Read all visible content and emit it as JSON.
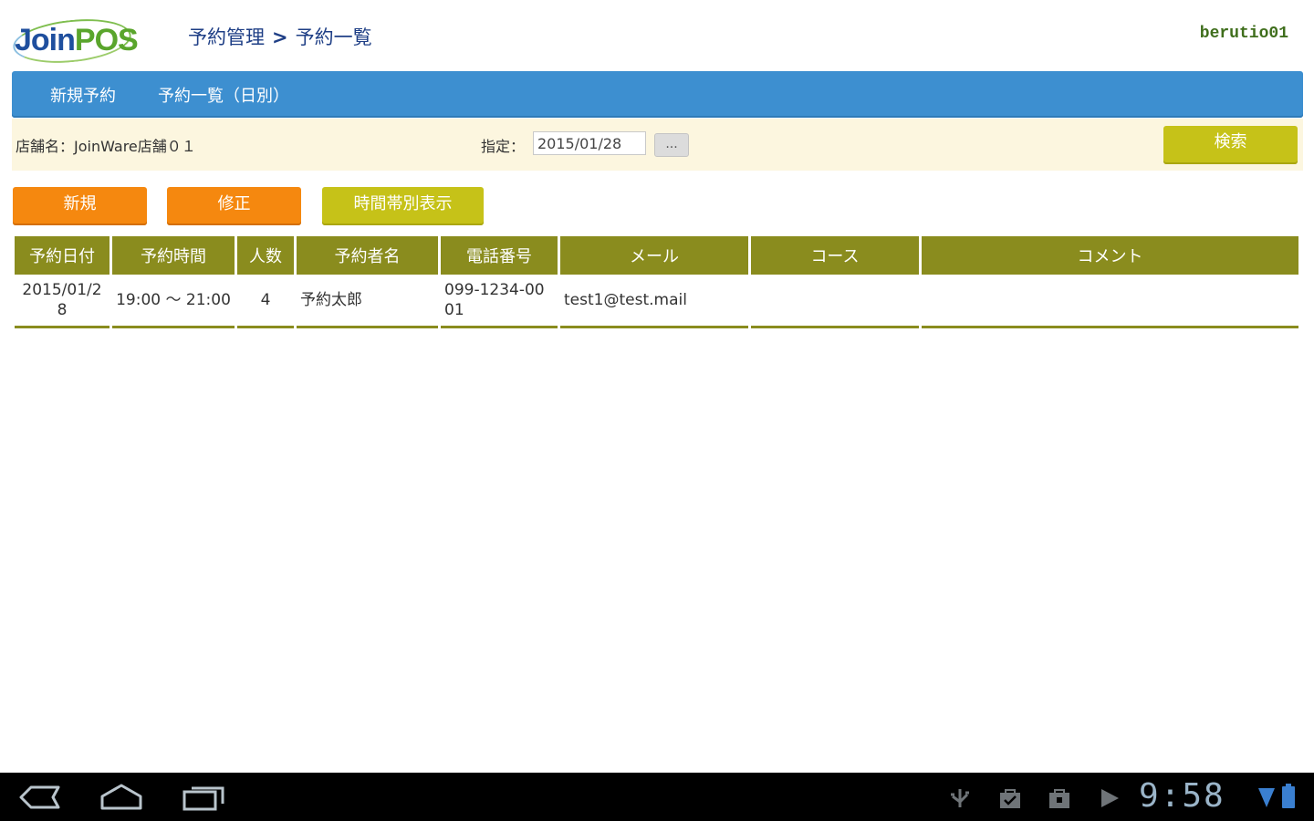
{
  "logo": {
    "part1": "Join",
    "part2": "POS"
  },
  "breadcrumb": {
    "section": "予約管理",
    "separator": ">",
    "page": "予約一覧"
  },
  "user": "berutio01",
  "nav": {
    "new_reservation": "新規予約",
    "daily_list": "予約一覧（日別）"
  },
  "filter": {
    "store_label": "店舗名：JoinWare店舗０１",
    "date_label": "指定：",
    "date_value": "2015/01/28",
    "date_picker": "...",
    "search_button": "検索"
  },
  "actions": {
    "new": "新規",
    "edit": "修正",
    "timeslot_view": "時間帯別表示"
  },
  "table": {
    "headers": [
      "予約日付",
      "予約時間",
      "人数",
      "予約者名",
      "電話番号",
      "メール",
      "コース",
      "コメント"
    ],
    "rows": [
      [
        "2015/01/28",
        "19:00 ～ 21:00",
        "4",
        "予約太郎",
        "099-1234-0001",
        "test1@test.mail",
        "",
        ""
      ]
    ]
  },
  "system_bar": {
    "clock": "9:58"
  },
  "colors": {
    "nav_blue": "#3d8fd0",
    "olive_header": "#8a8c1e",
    "orange_button": "#f5880f",
    "yellow_button": "#c6c218",
    "filter_background": "#fcf6df"
  },
  "icons": {
    "system_nav": [
      "back-icon",
      "home-icon",
      "recent-apps-icon"
    ],
    "status": [
      "usb-icon",
      "bag-check-icon",
      "bag-icon",
      "play-store-icon",
      "wifi-icon",
      "battery-icon"
    ]
  }
}
